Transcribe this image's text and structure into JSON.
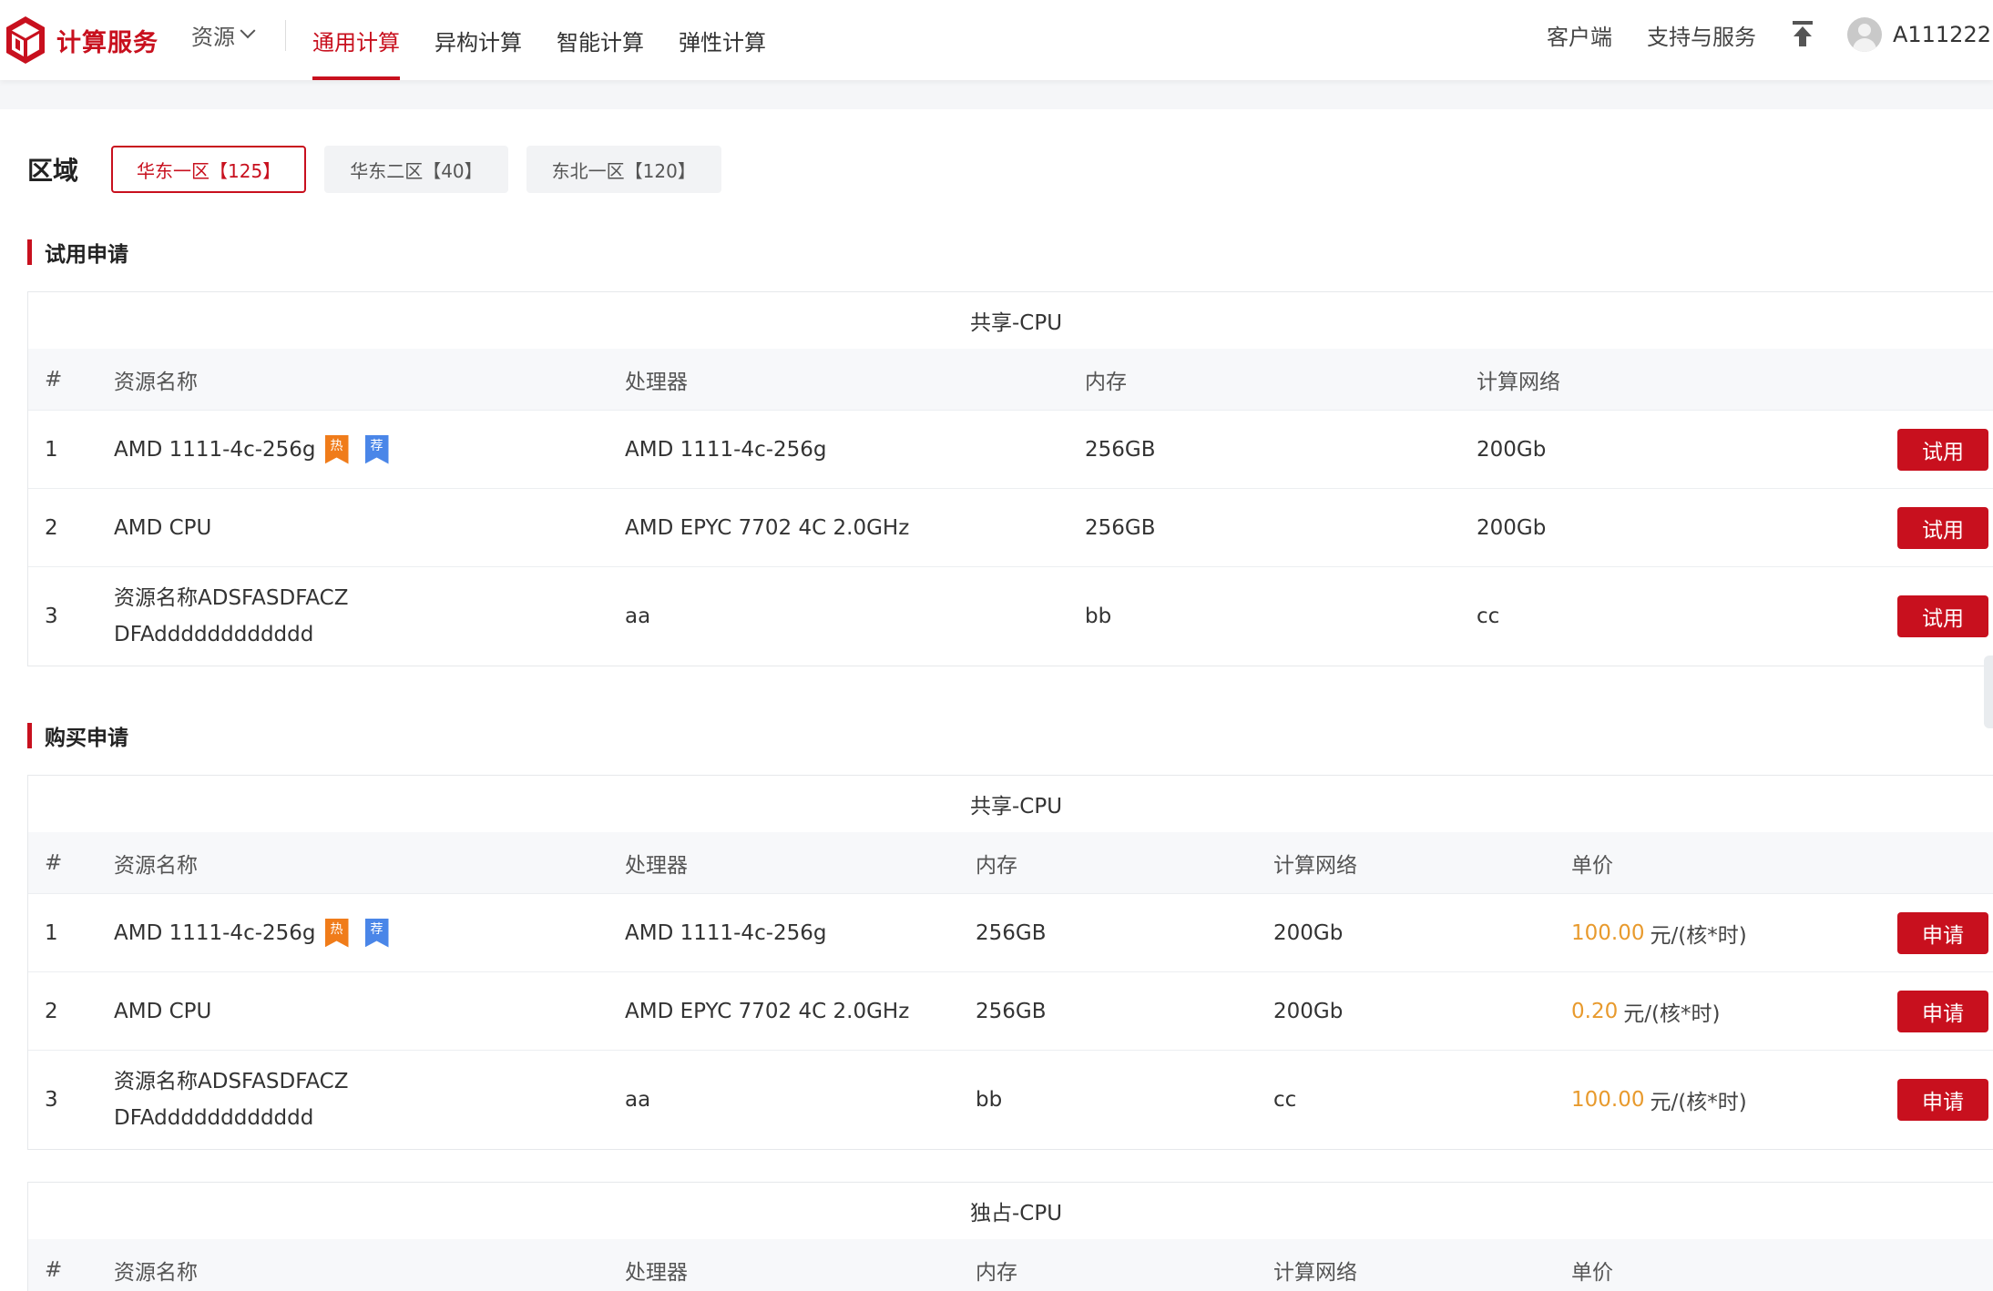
{
  "header": {
    "logo_text": "计算服务",
    "resource_menu": "资源",
    "nav": [
      "通用计算",
      "异构计算",
      "智能计算",
      "弹性计算"
    ],
    "client": "客户端",
    "support": "支持与服务",
    "username": "A111222",
    "colors": {
      "brand": "#c8101e"
    }
  },
  "region": {
    "label": "区域",
    "tabs": [
      "华东一区【125】",
      "华东二区【40】",
      "东北一区【120】"
    ],
    "active": "华东一区【125】"
  },
  "trial": {
    "title": "试用申请",
    "caption": "共享-CPU",
    "headers": [
      "#",
      "资源名称",
      "处理器",
      "内存",
      "计算网络"
    ],
    "rows": [
      {
        "idx": "1",
        "name": "AMD 1111-4c-256g",
        "cpu": "AMD 1111-4c-256g",
        "mem": "256GB",
        "net": "200Gb",
        "hot": "热",
        "rec": "荐",
        "action": "试用"
      },
      {
        "idx": "2",
        "name": "AMD CPU",
        "cpu": "AMD EPYC 7702 4C 2.0GHz",
        "mem": "256GB",
        "net": "200Gb",
        "action": "试用"
      },
      {
        "idx": "3",
        "name_line1": "资源名称ADSFASDFACZ",
        "name_line2": "DFAdddddddddddd",
        "cpu": "aa",
        "mem": "bb",
        "net": "cc",
        "action": "试用"
      }
    ]
  },
  "purchase": {
    "title": "购买申请",
    "caption": "共享-CPU",
    "headers": [
      "#",
      "资源名称",
      "处理器",
      "内存",
      "计算网络",
      "单价"
    ],
    "rows": [
      {
        "idx": "1",
        "name": "AMD 1111-4c-256g",
        "cpu": "AMD 1111-4c-256g",
        "mem": "256GB",
        "net": "200Gb",
        "price": "100.00",
        "unit": "元/(核*时)",
        "hot": "热",
        "rec": "荐",
        "action": "申请"
      },
      {
        "idx": "2",
        "name": "AMD CPU",
        "cpu": "AMD EPYC 7702 4C 2.0GHz",
        "mem": "256GB",
        "net": "200Gb",
        "price": "0.20",
        "unit": "元/(核*时)",
        "action": "申请"
      },
      {
        "idx": "3",
        "name_line1": "资源名称ADSFASDFACZ",
        "name_line2": "DFAdddddddddddd",
        "cpu": "aa",
        "mem": "bb",
        "net": "cc",
        "price": "100.00",
        "unit": "元/(核*时)",
        "action": "申请"
      }
    ]
  },
  "exclusive": {
    "caption": "独占-CPU",
    "headers": [
      "#",
      "资源名称",
      "处理器",
      "内存",
      "计算网络",
      "单价"
    ]
  }
}
